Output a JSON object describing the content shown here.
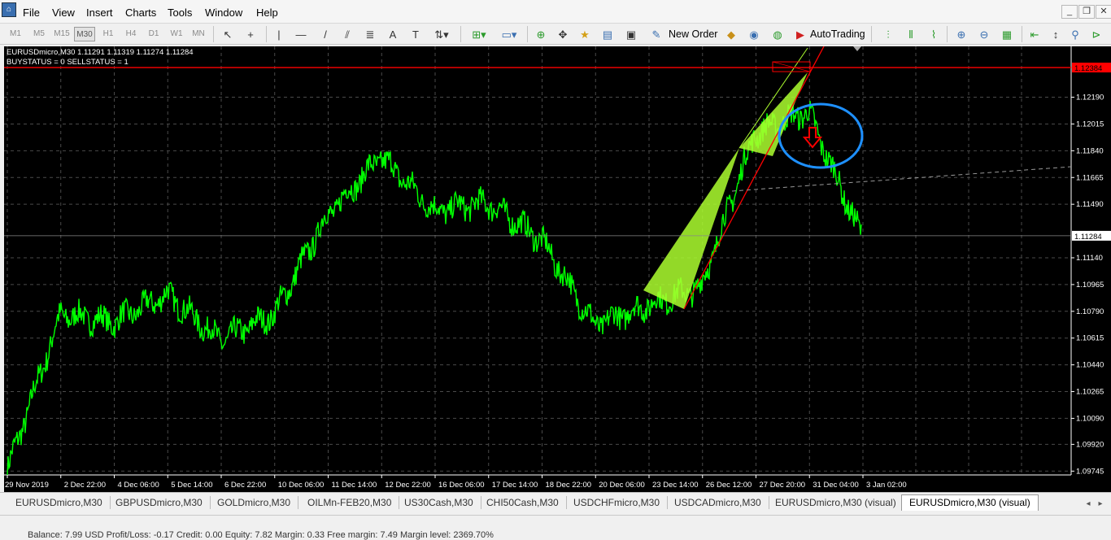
{
  "menu": [
    "File",
    "View",
    "Insert",
    "Charts",
    "Tools",
    "Window",
    "Help"
  ],
  "timeframes": [
    "M1",
    "M5",
    "M15",
    "M30",
    "H1",
    "H4",
    "D1",
    "W1",
    "MN"
  ],
  "active_timeframe": "M30",
  "toolbar": {
    "new_order_label": "New Order",
    "autotrading_label": "AutoTrading"
  },
  "chart": {
    "symbol_line": "EURUSDmicro,M30  1.11291 1.11319 1.11274 1.11284",
    "status_line": "BUYSTATUS = 0   SELLSTATUS = 1",
    "price_labels": [
      "1.12190",
      "1.12015",
      "1.11840",
      "1.11665",
      "1.11490",
      "1.11140",
      "1.10965",
      "1.10790",
      "1.10615",
      "1.10440",
      "1.10265",
      "1.10090",
      "1.09920",
      "1.09745"
    ],
    "price_min": 1.0972,
    "price_max": 1.1248,
    "current_price": "1.11284",
    "current_price_value": 1.11284,
    "red_line_label": "1.12384",
    "red_line_value": 1.12384,
    "date_labels": [
      "29 Nov 2019",
      "2 Dec 22:00",
      "4 Dec 06:00",
      "5 Dec 14:00",
      "6 Dec 22:00",
      "10 Dec 06:00",
      "11 Dec 14:00",
      "12 Dec 22:00",
      "16 Dec 06:00",
      "17 Dec 14:00",
      "18 Dec 22:00",
      "20 Dec 06:00",
      "23 Dec 14:00",
      "26 Dec 12:00",
      "27 Dec 20:00",
      "31 Dec 04:00",
      "3 Jan 02:00"
    ],
    "colors": {
      "background": "#000000",
      "price_line": "#00ff00",
      "triangle": "#adff2f",
      "red_level": "#ff0000",
      "circle": "#1e90ff",
      "grid": "#4a4a4a"
    }
  },
  "chart_data": {
    "type": "line",
    "series": [
      {
        "name": "EURUSDmicro,M30",
        "values": [
          {
            "t": "29 Nov 2019",
            "close": 1.0975
          },
          {
            "t": "2 Dec 22:00",
            "close": 1.1077
          },
          {
            "t": "4 Dec 06:00",
            "close": 1.1072
          },
          {
            "t": "5 Dec 14:00",
            "close": 1.109
          },
          {
            "t": "6 Dec 22:00",
            "close": 1.106
          },
          {
            "t": "10 Dec 06:00",
            "close": 1.1077
          },
          {
            "t": "11 Dec 14:00",
            "close": 1.1142
          },
          {
            "t": "12 Dec 22:00",
            "close": 1.118
          },
          {
            "t": "16 Dec 06:00",
            "close": 1.1145
          },
          {
            "t": "17 Dec 14:00",
            "close": 1.115
          },
          {
            "t": "18 Dec 22:00",
            "close": 1.1126
          },
          {
            "t": "20 Dec 06:00",
            "close": 1.107
          },
          {
            "t": "23 Dec 14:00",
            "close": 1.1083
          },
          {
            "t": "26 Dec 12:00",
            "close": 1.1095
          },
          {
            "t": "27 Dec 20:00",
            "close": 1.1195
          },
          {
            "t": "31 Dec 04:00",
            "close": 1.121
          },
          {
            "t": "3 Jan 02:00",
            "close": 1.1128
          }
        ]
      }
    ],
    "ylim": [
      1.0972,
      1.1248
    ],
    "grid": true
  },
  "tabs": [
    "EURUSDmicro,M30",
    "GBPUSDmicro,M30",
    "GOLDmicro,M30",
    "OILMn-FEB20,M30",
    "US30Cash,M30",
    "CHI50Cash,M30",
    "USDCHFmicro,M30",
    "USDCADmicro,M30",
    "EURUSDmicro,M30 (visual)",
    "EURUSDmicro,M30 (visual)"
  ],
  "active_tab_index": 9,
  "status_text": "Balance: 7.99 USD   Profit/Loss: -0.17   Credit: 0.00   Equity: 7.82   Margin: 0.33   Free margin: 7.49   Margin level: 2369.70%"
}
